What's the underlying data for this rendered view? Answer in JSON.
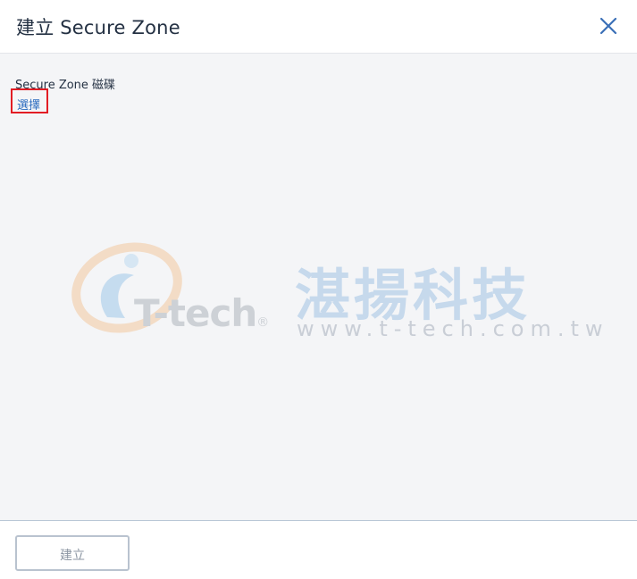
{
  "dialog": {
    "title": "建立 Secure Zone",
    "close_icon": "close-icon"
  },
  "content": {
    "field_label": "Secure Zone 磁碟",
    "select_link": "選擇"
  },
  "watermark": {
    "chinese_name": "湛揚科技",
    "logo_text": "T-tech",
    "registered_mark": "®",
    "url": "www.t-tech.com.tw"
  },
  "footer": {
    "create_button": "建立"
  },
  "colors": {
    "title_text": "#243143",
    "link": "#2c6cbf",
    "highlight_border": "#e21d24",
    "content_bg": "#f4f5f7",
    "button_border": "#b9c3cf",
    "close_icon": "#3a6fb7"
  }
}
